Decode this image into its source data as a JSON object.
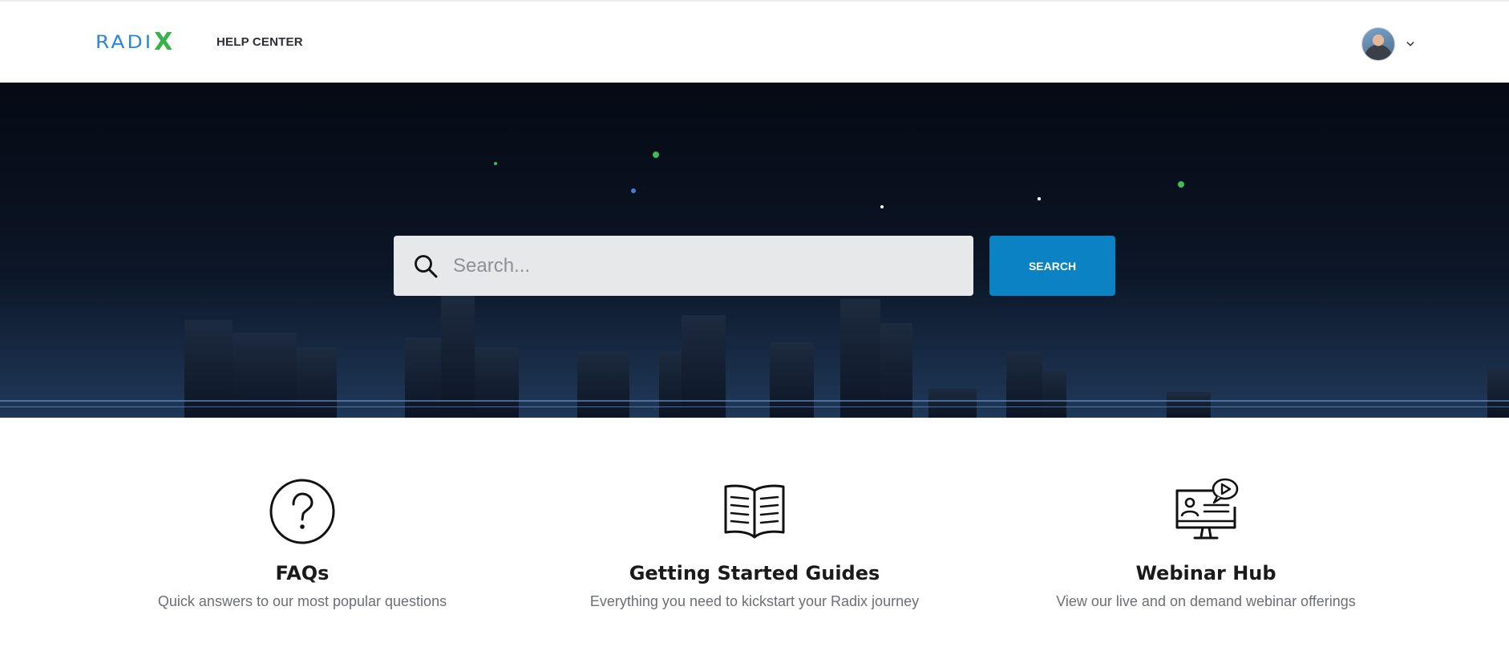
{
  "header": {
    "logo_text": "RADI",
    "logo_accent": "X",
    "title": "HELP CENTER",
    "avatar_icon": "user-avatar",
    "chevron_icon": "chevron-down-icon"
  },
  "hero": {
    "search": {
      "placeholder": "Search...",
      "button_label": "SEARCH"
    }
  },
  "cards": [
    {
      "icon": "question-circle-icon",
      "title": "FAQs",
      "description": "Quick answers to our most popular questions"
    },
    {
      "icon": "open-book-icon",
      "title": "Getting Started Guides",
      "description": "Everything you need to kickstart your Radix journey"
    },
    {
      "icon": "webinar-monitor-icon",
      "title": "Webinar Hub",
      "description": "View our live and on demand webinar offerings"
    }
  ],
  "colors": {
    "logo_blue": "#2a86d6",
    "logo_green": "#35b34a",
    "search_button": "#0a82c4",
    "hero_dark": "#0a1322"
  }
}
